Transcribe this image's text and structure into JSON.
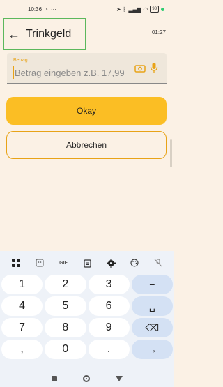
{
  "status_bar": {
    "time": "10:36",
    "icons": [
      "whatsapp-icon",
      "more-dots-icon"
    ],
    "right_icons": [
      "location-icon",
      "bluetooth-icon",
      "signal-icon",
      "wifi-icon"
    ],
    "battery": "98"
  },
  "header": {
    "title": "Trinkgeld",
    "time": "01:27"
  },
  "amount_field": {
    "label": "Betrag",
    "placeholder": "Betrag eingeben z.B. 17,99"
  },
  "buttons": {
    "okay": "Okay",
    "cancel": "Abbrechen"
  },
  "keyboard": {
    "toolbar": [
      "apps-icon",
      "sticker-icon",
      "GIF",
      "clipboard-icon",
      "settings-icon",
      "palette-icon",
      "mic-off-icon"
    ],
    "rows": [
      [
        "1",
        "2",
        "3",
        "−"
      ],
      [
        "4",
        "5",
        "6",
        "␣"
      ],
      [
        "7",
        "8",
        "9",
        "⌫"
      ],
      [
        ",",
        "0",
        ".",
        "→"
      ]
    ]
  },
  "nav_bar": {
    "icons": [
      "recents-icon",
      "home-icon",
      "back-icon"
    ]
  },
  "colors": {
    "background": "#FBF1E5",
    "accent": "#FBBE24",
    "header_border": "#5cb85c"
  }
}
